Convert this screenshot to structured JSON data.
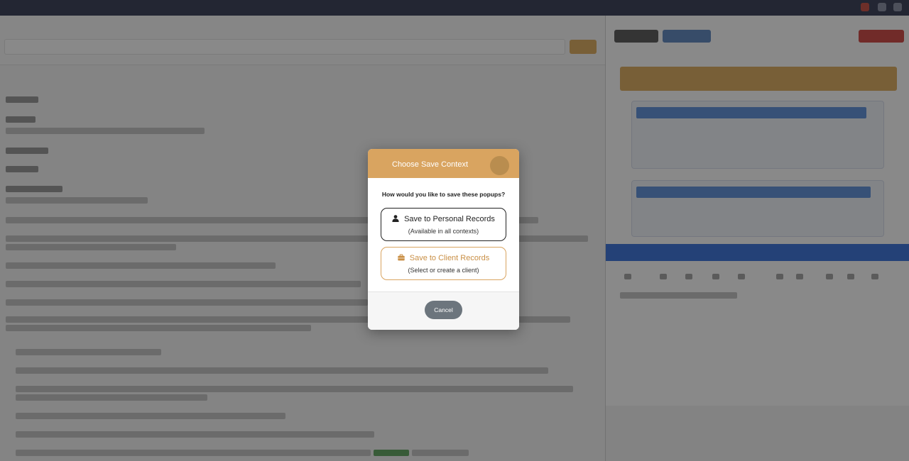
{
  "modal": {
    "title": "Choose Save Context",
    "question": "How would you like to save these popups?",
    "personal_option": {
      "label": "Save to Personal Records",
      "sublabel": "(Available in all contexts)",
      "icon": "user-icon"
    },
    "client_option": {
      "label": "Save to Client Records",
      "sublabel": "(Select or create a client)",
      "icon": "briefcase-icon"
    },
    "cancel_label": "Cancel",
    "close_icon": "close-icon"
  },
  "colors": {
    "header": "#d9a460",
    "client_accent": "#c98f45",
    "cancel": "#6c757d",
    "overlay": "rgba(40,40,40,0.55)"
  }
}
